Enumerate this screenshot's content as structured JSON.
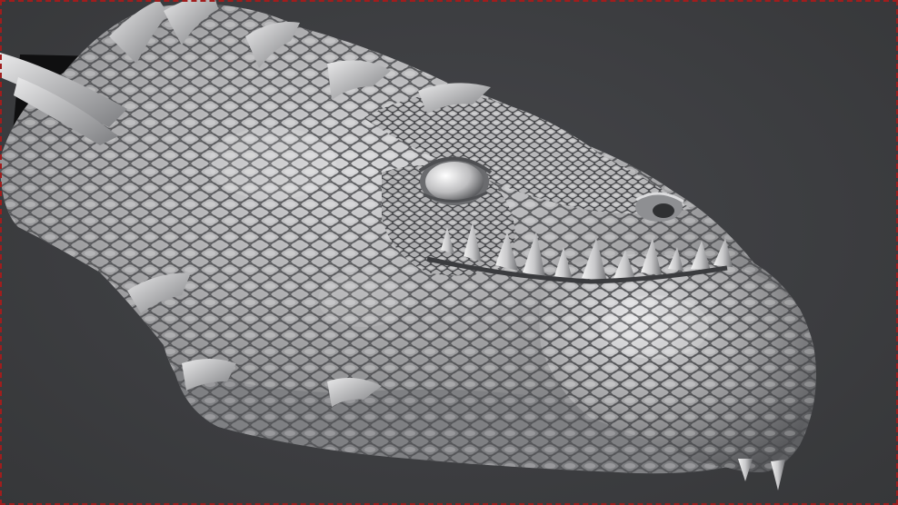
{
  "viewport": {
    "background_color": "#3d3e40",
    "border_color": "#a11d1d",
    "object": "sculpted-reptile-head-mesh",
    "mesh_color": "#a9a9ab",
    "highlight_color": "#e8e8e8",
    "shadow_color": "#4e4f52"
  }
}
